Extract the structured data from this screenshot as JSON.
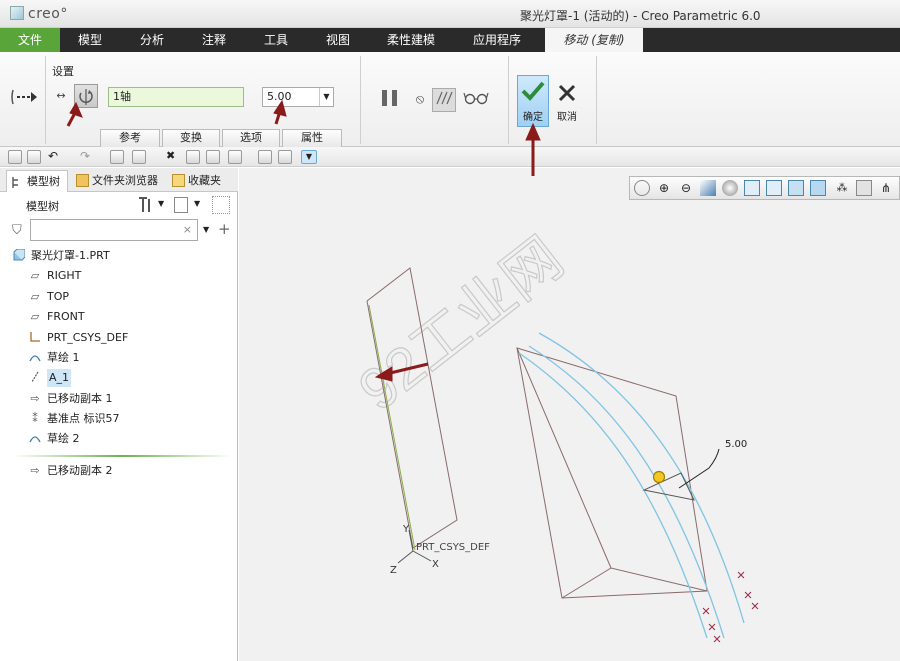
{
  "app": {
    "logo_text": "creo°",
    "window_title": "聚光灯罩-1 (活动的) - Creo Parametric 6.0"
  },
  "ribbon_tabs": [
    {
      "label": "文件"
    },
    {
      "label": "模型"
    },
    {
      "label": "分析"
    },
    {
      "label": "注释"
    },
    {
      "label": "工具"
    },
    {
      "label": "视图"
    },
    {
      "label": "柔性建模"
    },
    {
      "label": "应用程序"
    },
    {
      "label": "移动 (复制)"
    }
  ],
  "ribbon": {
    "settings_label": "设置",
    "reference_value": "1轴",
    "distance_value": "5.00",
    "subtabs": [
      {
        "label": "参考"
      },
      {
        "label": "变换"
      },
      {
        "label": "选项"
      },
      {
        "label": "属性"
      }
    ],
    "ok_label": "确定",
    "cancel_label": "取消"
  },
  "left_panel": {
    "tabs": [
      {
        "label": "模型树"
      },
      {
        "label": "文件夹浏览器"
      },
      {
        "label": "收藏夹"
      }
    ],
    "tree_heading": "模型树",
    "search_placeholder": "",
    "tree_items": [
      {
        "label": "聚光灯罩-1.PRT",
        "icon": "part-icon"
      },
      {
        "label": "RIGHT",
        "icon": "datum-plane-icon"
      },
      {
        "label": "TOP",
        "icon": "datum-plane-icon"
      },
      {
        "label": "FRONT",
        "icon": "datum-plane-icon"
      },
      {
        "label": "PRT_CSYS_DEF",
        "icon": "coordinate-system-icon"
      },
      {
        "label": "草绘 1",
        "icon": "sketch-icon"
      },
      {
        "label": "A_1",
        "icon": "axis-icon"
      },
      {
        "label": "已移动副本 1",
        "icon": "moved-copy-icon"
      },
      {
        "label": "基准点 标识57",
        "icon": "datum-point-icon"
      },
      {
        "label": "草绘 2",
        "icon": "sketch-icon"
      },
      {
        "label": "已移动副本 2",
        "icon": "moved-copy-icon"
      }
    ]
  },
  "graphics": {
    "dimension_value": "5.00",
    "csys_label": "PRT_CSYS_DEF",
    "axis_y": "Y",
    "axis_z": "Z",
    "axis_x": "X",
    "watermark": "92工业网"
  },
  "colors": {
    "file_tab": "#5aa53a",
    "ribbon_dark": "#2a2a2a",
    "ok_button": "#9fd0f2",
    "curve": "#7fc4e3",
    "geometry": "#8a6a6a",
    "arrow": "#8b1a1a"
  }
}
